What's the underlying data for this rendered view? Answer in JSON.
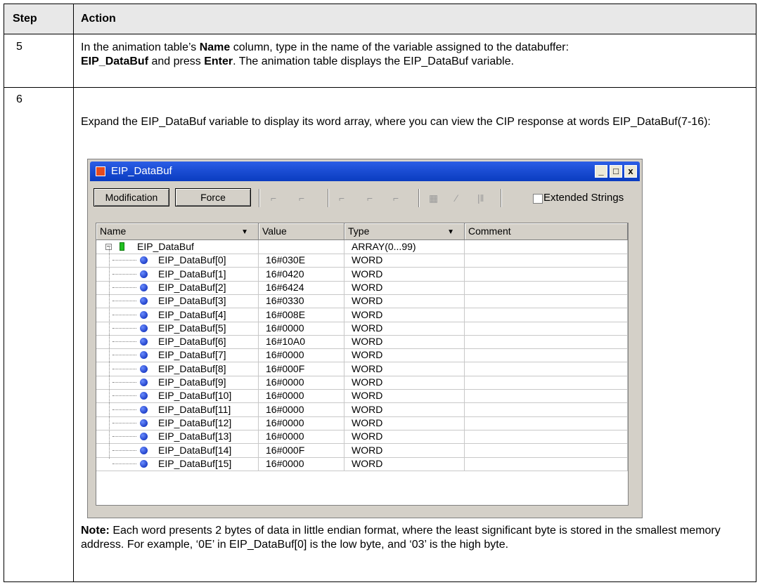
{
  "table": {
    "col_step": "Step",
    "col_action": "Action"
  },
  "row5": {
    "step": "5",
    "t1": "In the animation table’s ",
    "b1": "Name",
    "t2": " column, type in the name of the variable assigned to the databuffer:",
    "b2": "EIP_DataBuf",
    "t3": " and press ",
    "b3": "Enter",
    "t4": ". The animation table displays the EIP_DataBuf variable."
  },
  "row6": {
    "step": "6",
    "intro": "Expand the EIP_DataBuf variable to display its word array, where you can view the CIP response at words EIP_DataBuf(7-16):",
    "note_label": "Note:",
    "note_text": " Each word presents 2 bytes of data in little endian format, where the least significant byte is stored in the smallest memory address. For example, ‘0E’ in EIP_DataBuf[0] is the low byte, and ‘03’ is the high byte."
  },
  "window": {
    "title": "EIP_DataBuf",
    "minimize": "_",
    "maximize": "□",
    "close": "x",
    "modification_button": "Modification",
    "force_button": "Force",
    "extended_strings_label": "Extended Strings",
    "extended_strings_checked": false
  },
  "grid": {
    "columns": [
      "Name",
      "Value",
      "Type",
      "Comment"
    ],
    "root": {
      "name": "EIP_DataBuf",
      "value": "",
      "type": "ARRAY(0...99)",
      "comment": ""
    },
    "rows": [
      {
        "name": "EIP_DataBuf[0]",
        "value": "16#030E",
        "type": "WORD",
        "comment": ""
      },
      {
        "name": "EIP_DataBuf[1]",
        "value": "16#0420",
        "type": "WORD",
        "comment": ""
      },
      {
        "name": "EIP_DataBuf[2]",
        "value": "16#6424",
        "type": "WORD",
        "comment": ""
      },
      {
        "name": "EIP_DataBuf[3]",
        "value": "16#0330",
        "type": "WORD",
        "comment": ""
      },
      {
        "name": "EIP_DataBuf[4]",
        "value": "16#008E",
        "type": "WORD",
        "comment": ""
      },
      {
        "name": "EIP_DataBuf[5]",
        "value": "16#0000",
        "type": "WORD",
        "comment": ""
      },
      {
        "name": "EIP_DataBuf[6]",
        "value": "16#10A0",
        "type": "WORD",
        "comment": ""
      },
      {
        "name": "EIP_DataBuf[7]",
        "value": "16#0000",
        "type": "WORD",
        "comment": ""
      },
      {
        "name": "EIP_DataBuf[8]",
        "value": "16#000F",
        "type": "WORD",
        "comment": ""
      },
      {
        "name": "EIP_DataBuf[9]",
        "value": "16#0000",
        "type": "WORD",
        "comment": ""
      },
      {
        "name": "EIP_DataBuf[10]",
        "value": "16#0000",
        "type": "WORD",
        "comment": ""
      },
      {
        "name": "EIP_DataBuf[11]",
        "value": "16#0000",
        "type": "WORD",
        "comment": ""
      },
      {
        "name": "EIP_DataBuf[12]",
        "value": "16#0000",
        "type": "WORD",
        "comment": ""
      },
      {
        "name": "EIP_DataBuf[13]",
        "value": "16#0000",
        "type": "WORD",
        "comment": ""
      },
      {
        "name": "EIP_DataBuf[14]",
        "value": "16#000F",
        "type": "WORD",
        "comment": ""
      },
      {
        "name": "EIP_DataBuf[15]",
        "value": "16#0000",
        "type": "WORD",
        "comment": ""
      }
    ]
  }
}
